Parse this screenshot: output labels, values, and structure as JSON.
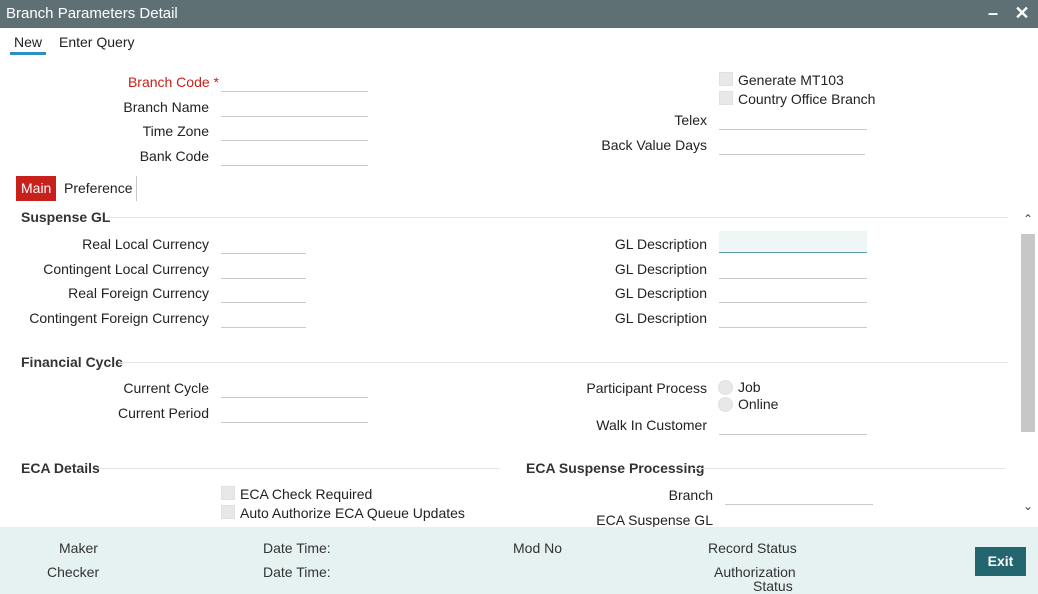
{
  "window": {
    "title": "Branch Parameters Detail"
  },
  "toolbar": {
    "new_label": "New",
    "query_label": "Enter Query"
  },
  "header": {
    "branch_code_label": "Branch Code",
    "required_mark": "*",
    "branch_name_label": "Branch Name",
    "time_zone_label": "Time Zone",
    "bank_code_label": "Bank Code",
    "generate_mt103_label": "Generate MT103",
    "country_office_label": "Country Office Branch",
    "telex_label": "Telex",
    "back_value_days_label": "Back Value Days"
  },
  "tabs": {
    "main": "Main",
    "preference": "Preference"
  },
  "suspense_gl": {
    "title": "Suspense GL",
    "real_local": "Real Local Currency",
    "contingent_local": "Contingent Local Currency",
    "real_foreign": "Real Foreign Currency",
    "contingent_foreign": "Contingent Foreign Currency",
    "gl_description": "GL Description"
  },
  "financial_cycle": {
    "title": "Financial Cycle",
    "current_cycle": "Current Cycle",
    "current_period": "Current Period",
    "participant_process": "Participant Process",
    "job": "Job",
    "online": "Online",
    "walk_in_customer": "Walk In Customer"
  },
  "eca": {
    "title": "ECA Details",
    "check_required": "ECA Check Required",
    "auto_authorize": "Auto Authorize ECA Queue Updates",
    "suspense_title": "ECA Suspense Processing",
    "branch": "Branch",
    "suspense_gl": "ECA Suspense GL"
  },
  "footer": {
    "maker": "Maker",
    "checker": "Checker",
    "date_time": "Date Time:",
    "mod_no": "Mod No",
    "record_status": "Record Status",
    "authorization": "Authorization",
    "status": "Status",
    "exit": "Exit"
  }
}
